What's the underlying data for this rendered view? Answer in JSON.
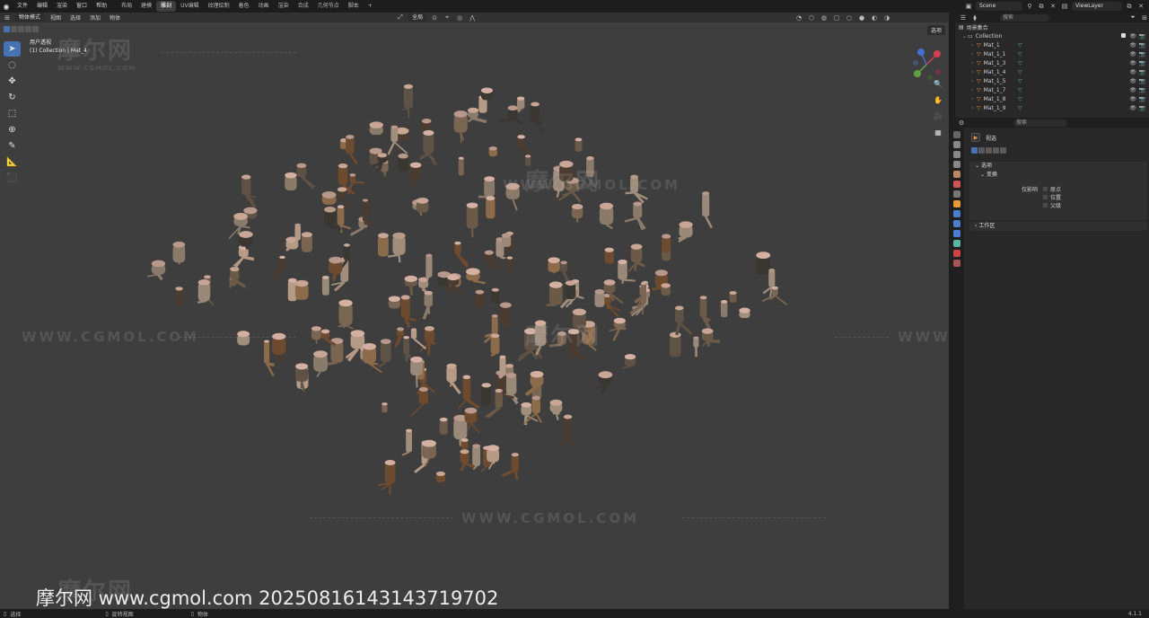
{
  "topbar": {
    "menu": [
      "文件",
      "编辑",
      "渲染",
      "窗口",
      "帮助"
    ],
    "workspaces": [
      "布局",
      "建模",
      "雕刻",
      "UV编辑",
      "纹理绘制",
      "着色",
      "动画",
      "渲染",
      "合成",
      "几何节点",
      "脚本",
      "+"
    ],
    "active_workspace": "雕刻",
    "scene": "Scene",
    "view_layer": "ViewLayer"
  },
  "viewport": {
    "mode": "物体模式",
    "header_menu": [
      "视图",
      "选择",
      "添加",
      "物体"
    ],
    "transform_orientation": "全局",
    "info_line1": "用户透视",
    "info_line2": "(1) Collection | Mat_4",
    "options_label": "选项",
    "overlay_text": "摩尔网 www.cgmol.com 20250816143143719702"
  },
  "watermarks": {
    "logo_text": "摩尔网",
    "url_text": "WWW.CGMOL.COM"
  },
  "outliner": {
    "search_placeholder": "搜索",
    "scene_collection": "场景集合",
    "collection": "Collection",
    "items": [
      "Mat_1",
      "Mat_1_1",
      "Mat_1_3",
      "Mat_1_4",
      "Mat_1_5",
      "Mat_1_7",
      "Mat_1_8",
      "Mat_1_9"
    ]
  },
  "properties": {
    "search_placeholder": "搜索",
    "object_name": "视选",
    "panel_relations": "选项",
    "sub_transform": "变换",
    "affect_label": "仅影响",
    "checkboxes": [
      "原点",
      "位置",
      "父级"
    ],
    "workspace_panel": "工作区"
  },
  "statusbar": {
    "left": "选择",
    "mid": "旋转视图",
    "obj": "物体",
    "version": "4.1.1"
  },
  "colors": {
    "accent": "#4772b3",
    "viewport_bg": "#3e3e3e",
    "mesh_orange": "#e69a3a"
  }
}
